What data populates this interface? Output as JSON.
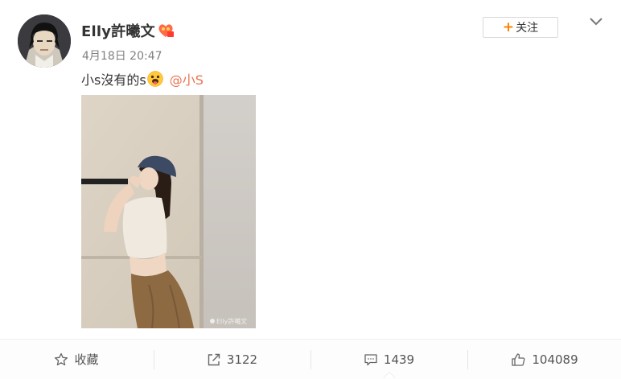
{
  "post": {
    "author_name": "Elly許曦文",
    "timestamp": "4月18日 20:47",
    "text_before_emoji": "小s沒有的s",
    "mention": "@小S",
    "follow_label": "关注",
    "follow_plus": "+",
    "emoji_icon": "tongue-out-emoji-icon",
    "badge_icon": "vip-badge-icon",
    "photo_watermark": "Elly許曦文",
    "mention_color": "#eb7350",
    "accent_color": "#ff8200"
  },
  "actions": {
    "favorite_label": "收藏",
    "repost_count": "3122",
    "comment_count": "1439",
    "like_count": "104089"
  }
}
